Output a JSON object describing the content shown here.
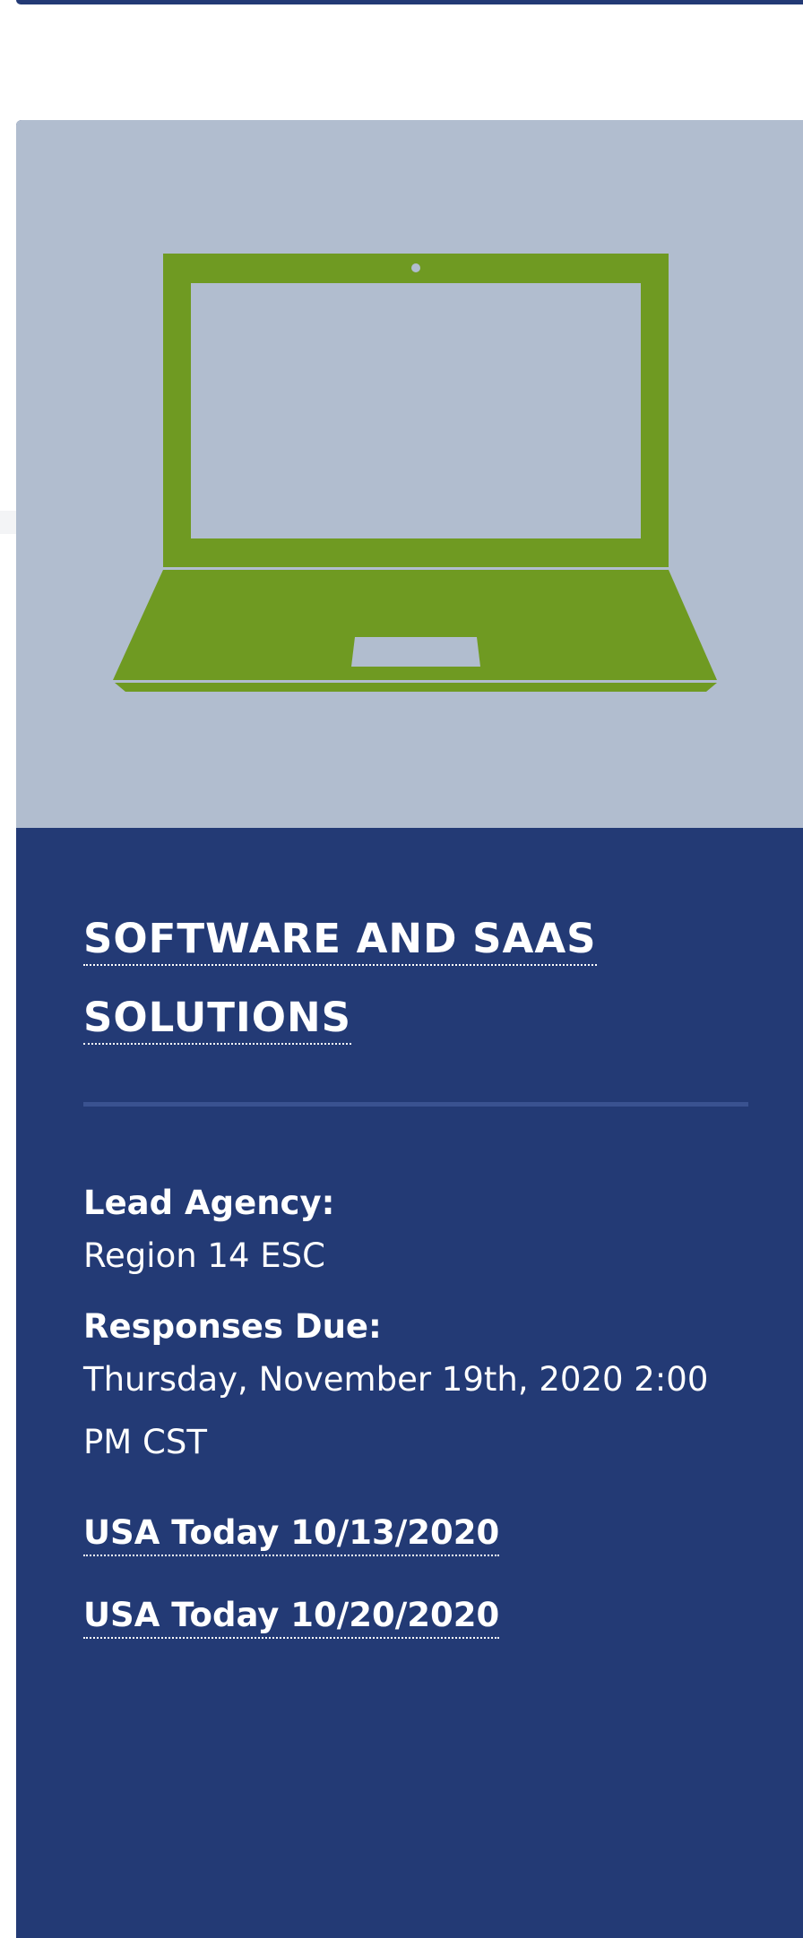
{
  "card": {
    "title": "SOFTWARE AND SAAS SOLUTIONS",
    "image": {
      "icon": "laptop-icon",
      "background_color": "#b1bdcf",
      "icon_color": "#6f9a22"
    },
    "lead_agency": {
      "label": "Lead Agency:",
      "value": "Region 14 ESC"
    },
    "responses_due": {
      "label": "Responses Due:",
      "value": "Thursday, November 19th, 2020 2:00 PM CST"
    },
    "links": [
      {
        "label": "USA Today 10/13/2020"
      },
      {
        "label": "USA Today 10/20/2020"
      }
    ]
  },
  "colors": {
    "card_background": "#233a75",
    "divider": "#3a5290",
    "text": "#ffffff"
  }
}
